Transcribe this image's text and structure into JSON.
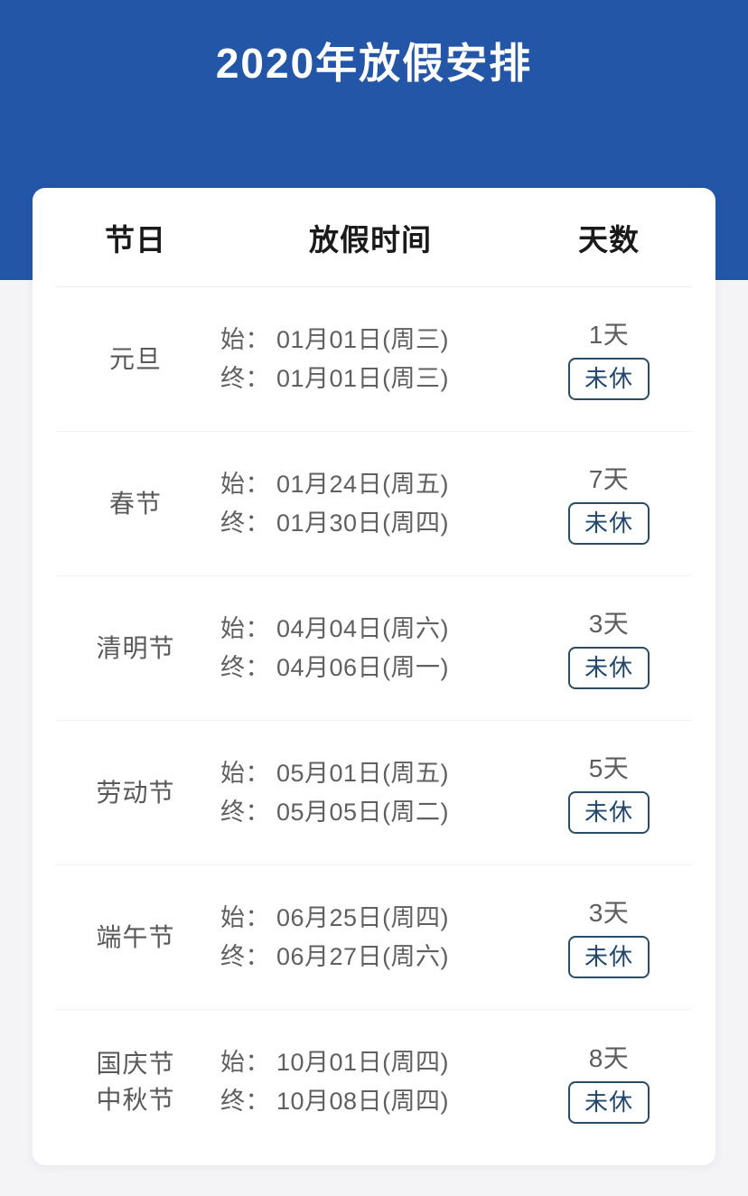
{
  "banner": {
    "title": "2020年放假安排",
    "background_color": "#2456a8",
    "title_color": "#ffffff"
  },
  "card": {
    "background_color": "#ffffff"
  },
  "table": {
    "headers": {
      "holiday": "节日",
      "dates": "放假时间",
      "days": "天数"
    },
    "labels": {
      "start": "始：",
      "end": "终："
    },
    "rows": [
      {
        "name_line1": "元旦",
        "name_line2": "",
        "start_label": "始：",
        "start_value": "01月01日(周三)",
        "end_label": "终：",
        "end_value": "01月01日(周三)",
        "days": "1天",
        "status": "未休"
      },
      {
        "name_line1": "春节",
        "name_line2": "",
        "start_label": "始：",
        "start_value": "01月24日(周五)",
        "end_label": "终：",
        "end_value": "01月30日(周四)",
        "days": "7天",
        "status": "未休"
      },
      {
        "name_line1": "清明节",
        "name_line2": "",
        "start_label": "始：",
        "start_value": "04月04日(周六)",
        "end_label": "终：",
        "end_value": "04月06日(周一)",
        "days": "3天",
        "status": "未休"
      },
      {
        "name_line1": "劳动节",
        "name_line2": "",
        "start_label": "始：",
        "start_value": "05月01日(周五)",
        "end_label": "终：",
        "end_value": "05月05日(周二)",
        "days": "5天",
        "status": "未休"
      },
      {
        "name_line1": "端午节",
        "name_line2": "",
        "start_label": "始：",
        "start_value": "06月25日(周四)",
        "end_label": "终：",
        "end_value": "06月27日(周六)",
        "days": "3天",
        "status": "未休"
      },
      {
        "name_line1": "国庆节",
        "name_line2": "中秋节",
        "start_label": "始：",
        "start_value": "10月01日(周四)",
        "end_label": "终：",
        "end_value": "10月08日(周四)",
        "days": "8天",
        "status": "未休"
      }
    ]
  },
  "colors": {
    "banner_blue": "#2456a8",
    "page_background": "#f4f4f7",
    "badge_border": "#2b4d63",
    "badge_text": "#21476f",
    "body_text": "#5d5d5d",
    "header_text": "#1a1a1a"
  }
}
